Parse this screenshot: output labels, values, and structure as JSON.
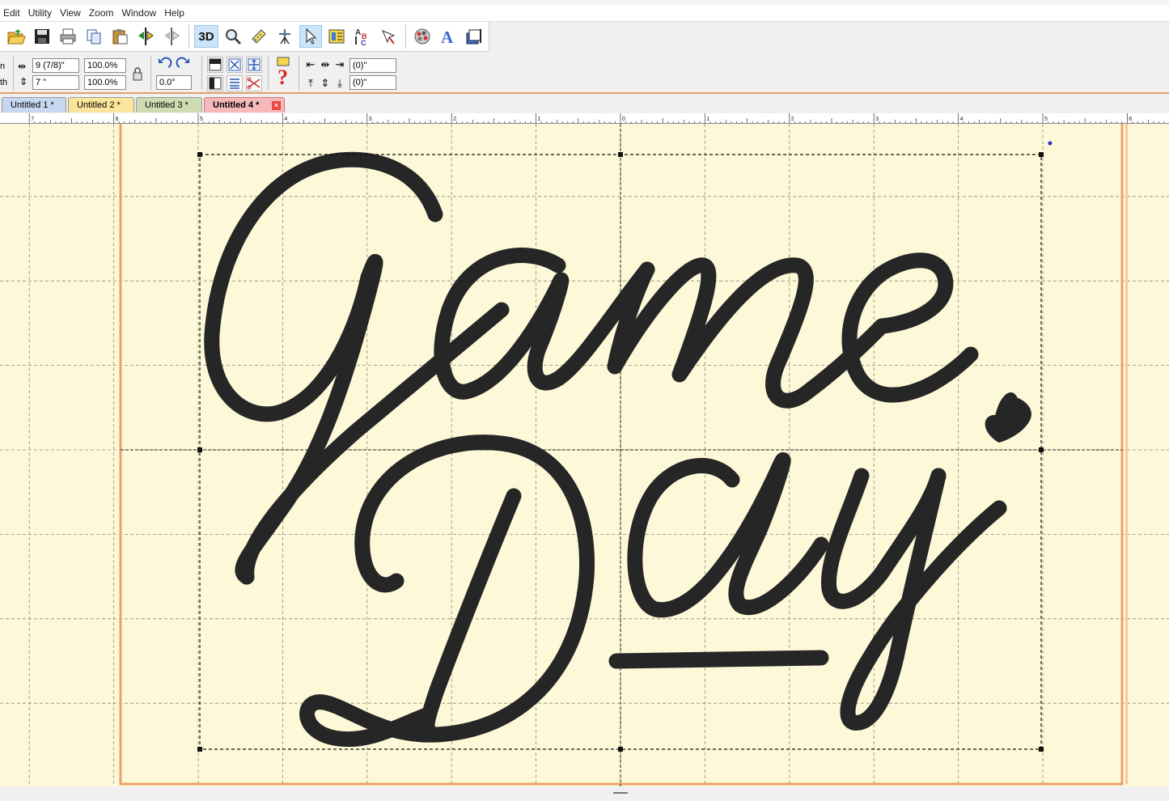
{
  "menu": [
    "Edit",
    "Utility",
    "View",
    "Zoom",
    "Window",
    "Help"
  ],
  "toolbar": {
    "view_3d_label": "3D",
    "icons": [
      "open-folder-icon",
      "save-icon",
      "print-icon",
      "copy-icon",
      "paste-icon",
      "mirror-horizontal-icon",
      "mirror-vertical-icon",
      "3d-view-icon",
      "zoom-icon",
      "ruler-icon",
      "stitch-player-icon",
      "select-pointer-icon",
      "properties-icon",
      "letter-text-icon",
      "color-sort-icon",
      "thread-palette-icon",
      "lettering-icon",
      "hoop-icon"
    ]
  },
  "properties": {
    "width_label_fragment": "n",
    "height_label_fragment": "th",
    "width_value": "9 (7/8)\"",
    "height_value": "7 \"",
    "width_scale": "100.0%",
    "height_scale": "100.0%",
    "rotation_value": "0.0°",
    "offset_x": "(0)\"",
    "offset_y": "(0)\""
  },
  "tabs": [
    {
      "label": "Untitled 1 *",
      "color": "#c7d7f0",
      "active": false
    },
    {
      "label": "Untitled 2 *",
      "color": "#fbe59a",
      "active": false
    },
    {
      "label": "Untitled 3 *",
      "color": "#cfdcb3",
      "active": false
    },
    {
      "label": "Untitled 4 *",
      "color": "#f6b9b9",
      "active": true
    }
  ],
  "ruler_labels": [
    "7",
    "6",
    "5",
    "4",
    "3",
    "2",
    "1",
    "0",
    "1",
    "2",
    "3",
    "4",
    "5",
    "6"
  ],
  "design": {
    "text": "Game Day",
    "thread_color": "#262626",
    "background_color": "#fdf9d8",
    "hoop_border_color": "#e9a36a"
  }
}
